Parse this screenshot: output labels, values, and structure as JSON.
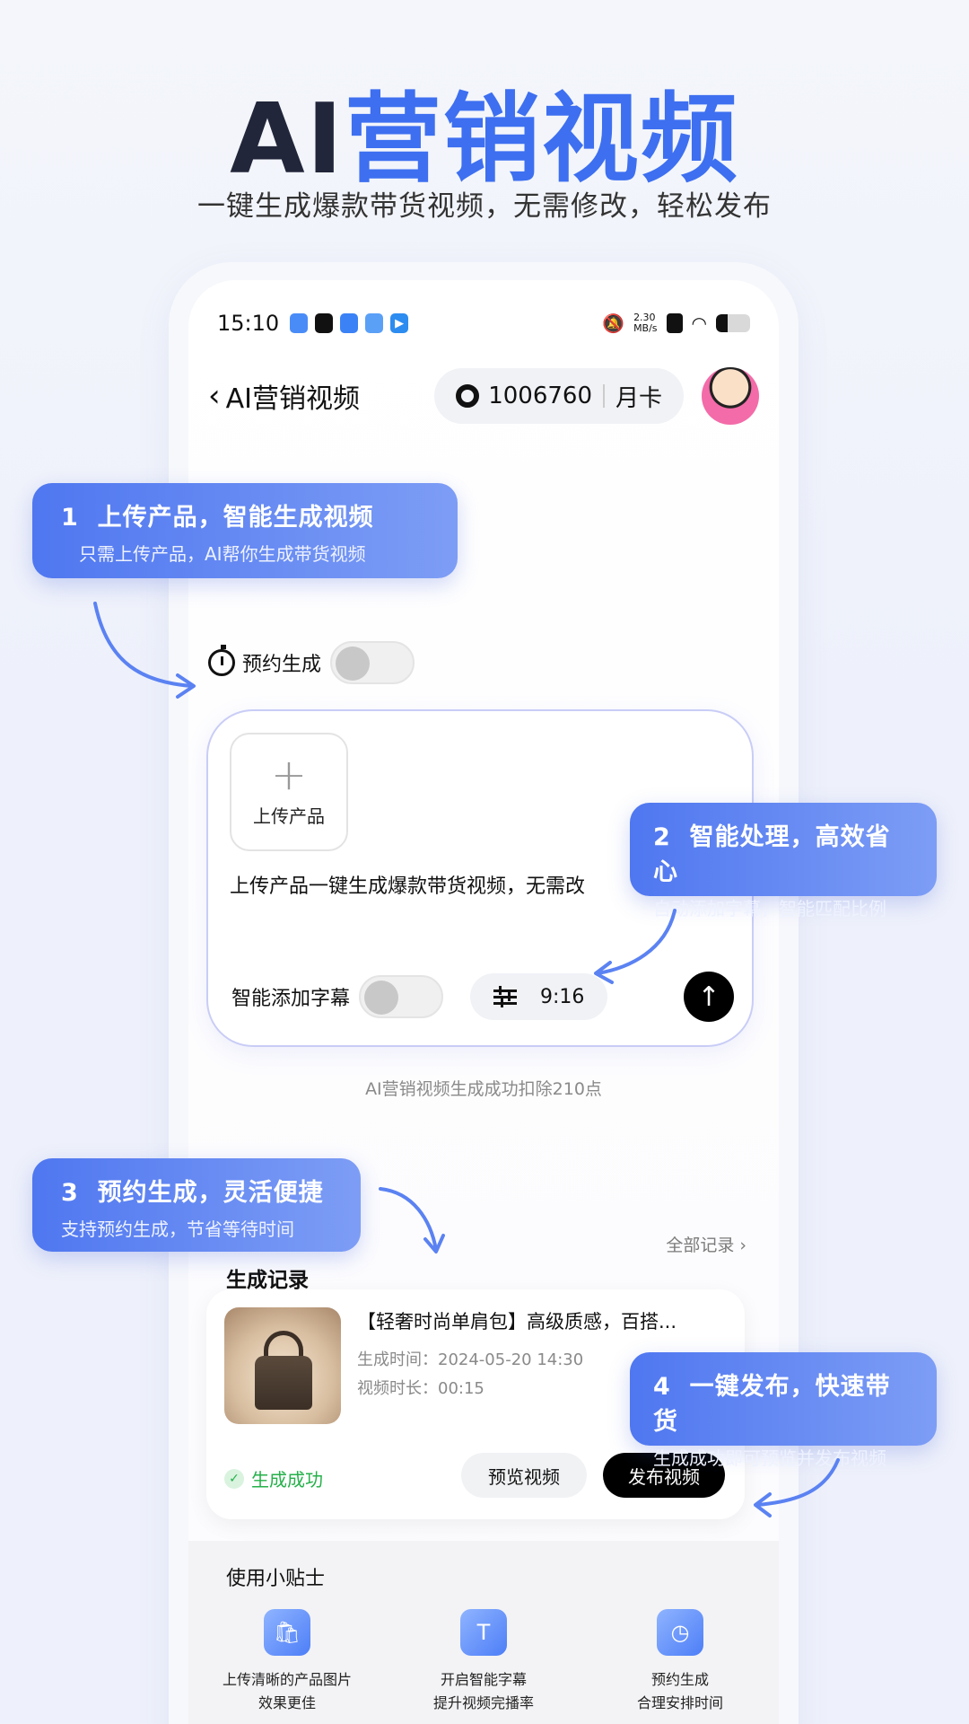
{
  "hero": {
    "title_ai": "AI",
    "title_rest": "营销视频",
    "subtitle": "一键生成爆款带货视频，无需修改，轻松发布"
  },
  "status_bar": {
    "time": "15:10",
    "net_speed_value": "2.30",
    "net_speed_unit": "MB/s",
    "battery_level": 0.35
  },
  "nav": {
    "back_icon": "chevron-left-icon",
    "title": "AI营销视频",
    "points": "1006760",
    "plan": "月卡"
  },
  "schedule": {
    "label": "预约生成",
    "enabled": false
  },
  "composer": {
    "upload_label": "上传产品",
    "prompt_text": "上传产品一键生成爆款带货视频，无需改",
    "subtitle_toggle_label": "智能添加字幕",
    "subtitle_enabled": false,
    "ratio": "9:16"
  },
  "deduct_note": "AI营销视频生成成功扣除210点",
  "records": {
    "section_title": "生成记录",
    "all_link": "全部记录",
    "items": [
      {
        "title": "【轻奢时尚单肩包】高级质感，百搭...",
        "time_label": "生成时间：",
        "time_value": "2024-05-20 14:30",
        "duration_label": "视频时长：",
        "duration_value": "00:15",
        "status": "生成成功",
        "preview_label": "预览视频",
        "publish_label": "发布视频"
      }
    ]
  },
  "tips": {
    "title": "使用小贴士",
    "items": [
      {
        "icon": "shopping-bag-icon",
        "line1": "上传清晰的产品图片",
        "line2": "效果更佳"
      },
      {
        "icon": "text-subtitle-icon",
        "line1": "开启智能字幕",
        "line2": "提升视频完播率"
      },
      {
        "icon": "clock-icon",
        "line1": "预约生成",
        "line2": "合理安排时间"
      }
    ]
  },
  "callouts": [
    {
      "num": "1",
      "title": "上传产品，智能生成视频",
      "sub": "只需上传产品，AI帮你生成带货视频"
    },
    {
      "num": "2",
      "title": "智能处理，高效省心",
      "sub": "自动添加字幕，智能匹配比例"
    },
    {
      "num": "3",
      "title": "预约生成，灵活便捷",
      "sub": "支持预约生成，节省等待时间"
    },
    {
      "num": "4",
      "title": "一键发布，快速带货",
      "sub": "生成成功即可预览并发布视频"
    }
  ],
  "colors": {
    "accent": "#3d6ff0",
    "callout_start": "#4f77f0",
    "callout_end": "#7d9df5",
    "success": "#25b04a"
  }
}
